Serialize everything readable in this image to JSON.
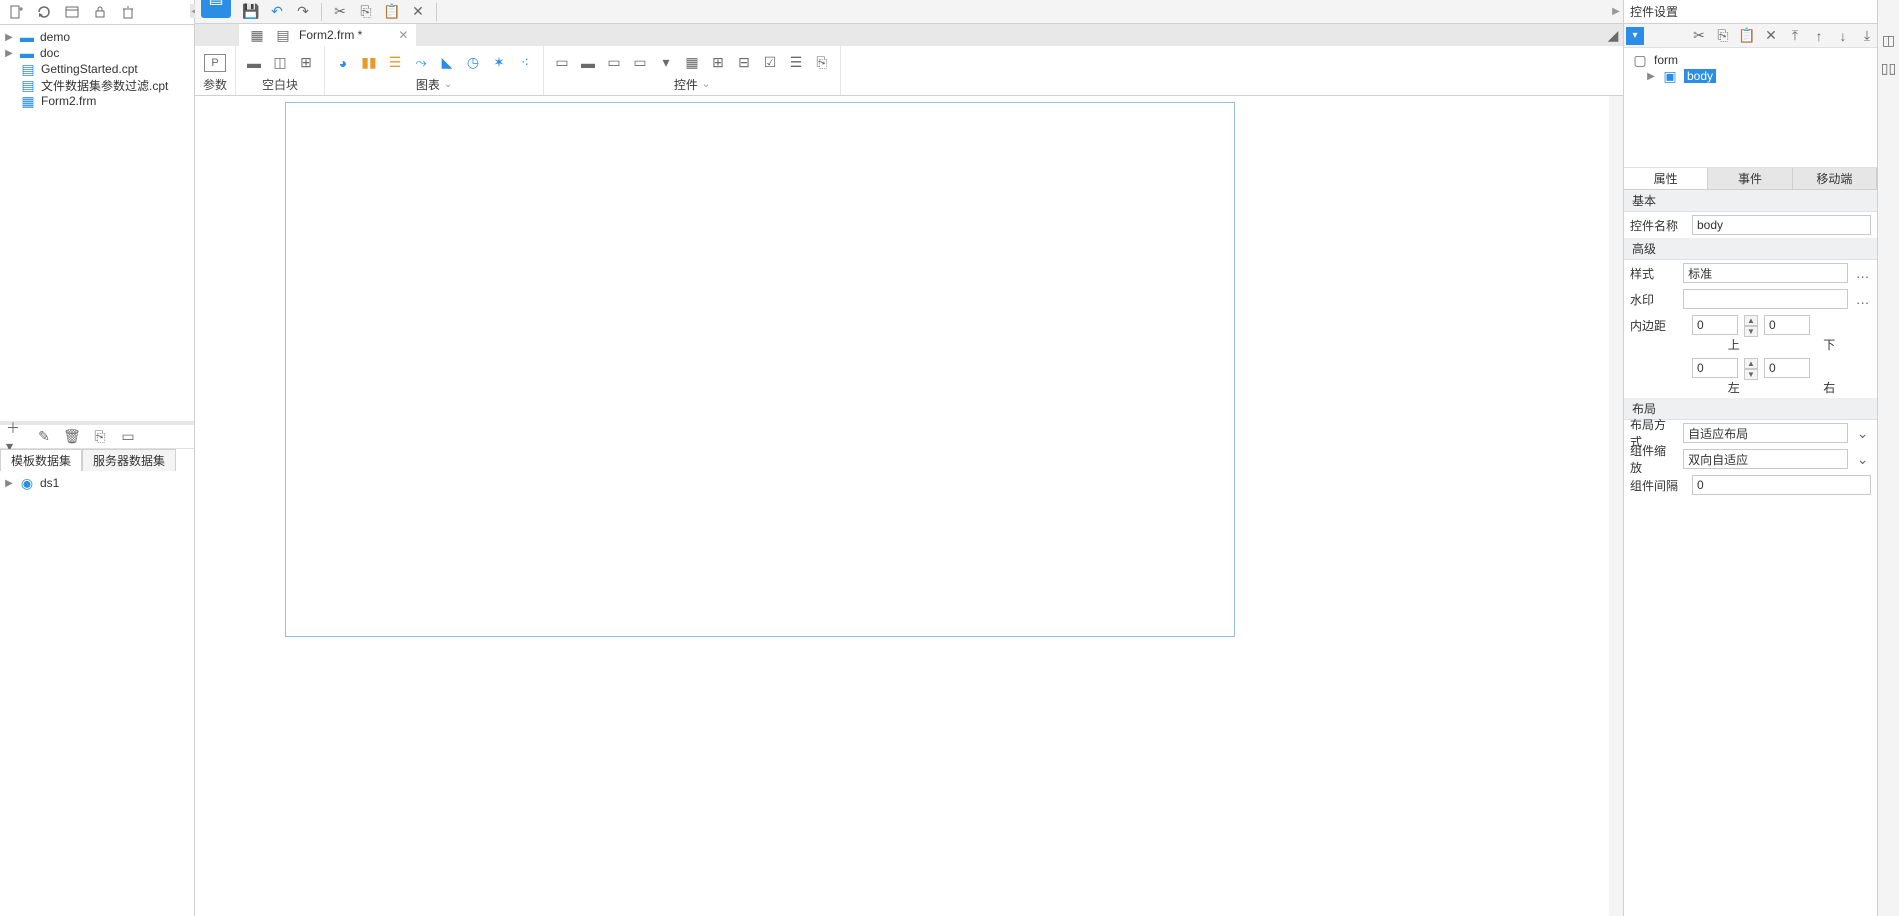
{
  "left": {
    "toolbar": [
      "new",
      "refresh",
      "view",
      "lock",
      "delete"
    ],
    "tree": [
      {
        "kind": "folder",
        "name": "demo",
        "indent": 0,
        "arrow": "▶"
      },
      {
        "kind": "folder",
        "name": "doc",
        "indent": 0,
        "arrow": "▶"
      },
      {
        "kind": "file",
        "name": "GettingStarted.cpt",
        "indent": 1
      },
      {
        "kind": "file",
        "name": "文件数据集参数过滤.cpt",
        "indent": 1
      },
      {
        "kind": "file",
        "name": "Form2.frm",
        "indent": 1
      }
    ],
    "ds_tabs": {
      "template": "模板数据集",
      "server": "服务器数据集"
    },
    "ds_items": [
      {
        "name": "ds1"
      }
    ]
  },
  "center": {
    "tab": {
      "name": "Form2.frm *"
    },
    "ribbon": {
      "g_param": "参数",
      "g_blank": "空白块",
      "g_chart": "图表",
      "g_widget": "控件"
    }
  },
  "right": {
    "title": "控件设置",
    "outline": {
      "root": "form",
      "child": "body"
    },
    "tabs": {
      "p": "属性",
      "e": "事件",
      "m": "移动端"
    },
    "sec_basic": "基本",
    "lbl_name": "控件名称",
    "val_name": "body",
    "sec_adv": "高级",
    "lbl_style": "样式",
    "val_style": "标准",
    "lbl_wm": "水印",
    "val_wm": "",
    "lbl_pad": "内边距",
    "pad_t": "0",
    "pad_b": "0",
    "pad_l": "0",
    "pad_r": "0",
    "pad_lbl_t": "上",
    "pad_lbl_b": "下",
    "pad_lbl_l": "左",
    "pad_lbl_r": "右",
    "sec_layout": "布局",
    "lbl_ltype": "布局方式",
    "val_ltype": "自适应布局",
    "lbl_scale": "组件缩放",
    "val_scale": "双向自适应",
    "lbl_gap": "组件间隔",
    "val_gap": "0"
  }
}
